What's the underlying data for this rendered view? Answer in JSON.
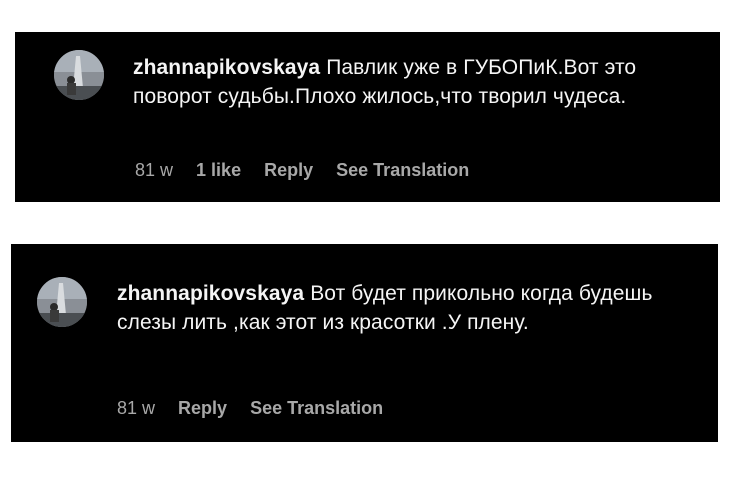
{
  "comments": [
    {
      "username": "zhannapikovskaya",
      "text": "Павлик уже в ГУБОПиК.Вот это поворот судьбы.Плохо жилось,что творил чудеса.",
      "time": "81 w",
      "likes": "1 like",
      "reply_label": "Reply",
      "translation_label": "See Translation"
    },
    {
      "username": "zhannapikovskaya",
      "text": "Вот будет прикольно когда будешь слезы лить ,как этот из красотки .У плену.",
      "time": "81 w",
      "reply_label": "Reply",
      "translation_label": "See Translation"
    }
  ]
}
